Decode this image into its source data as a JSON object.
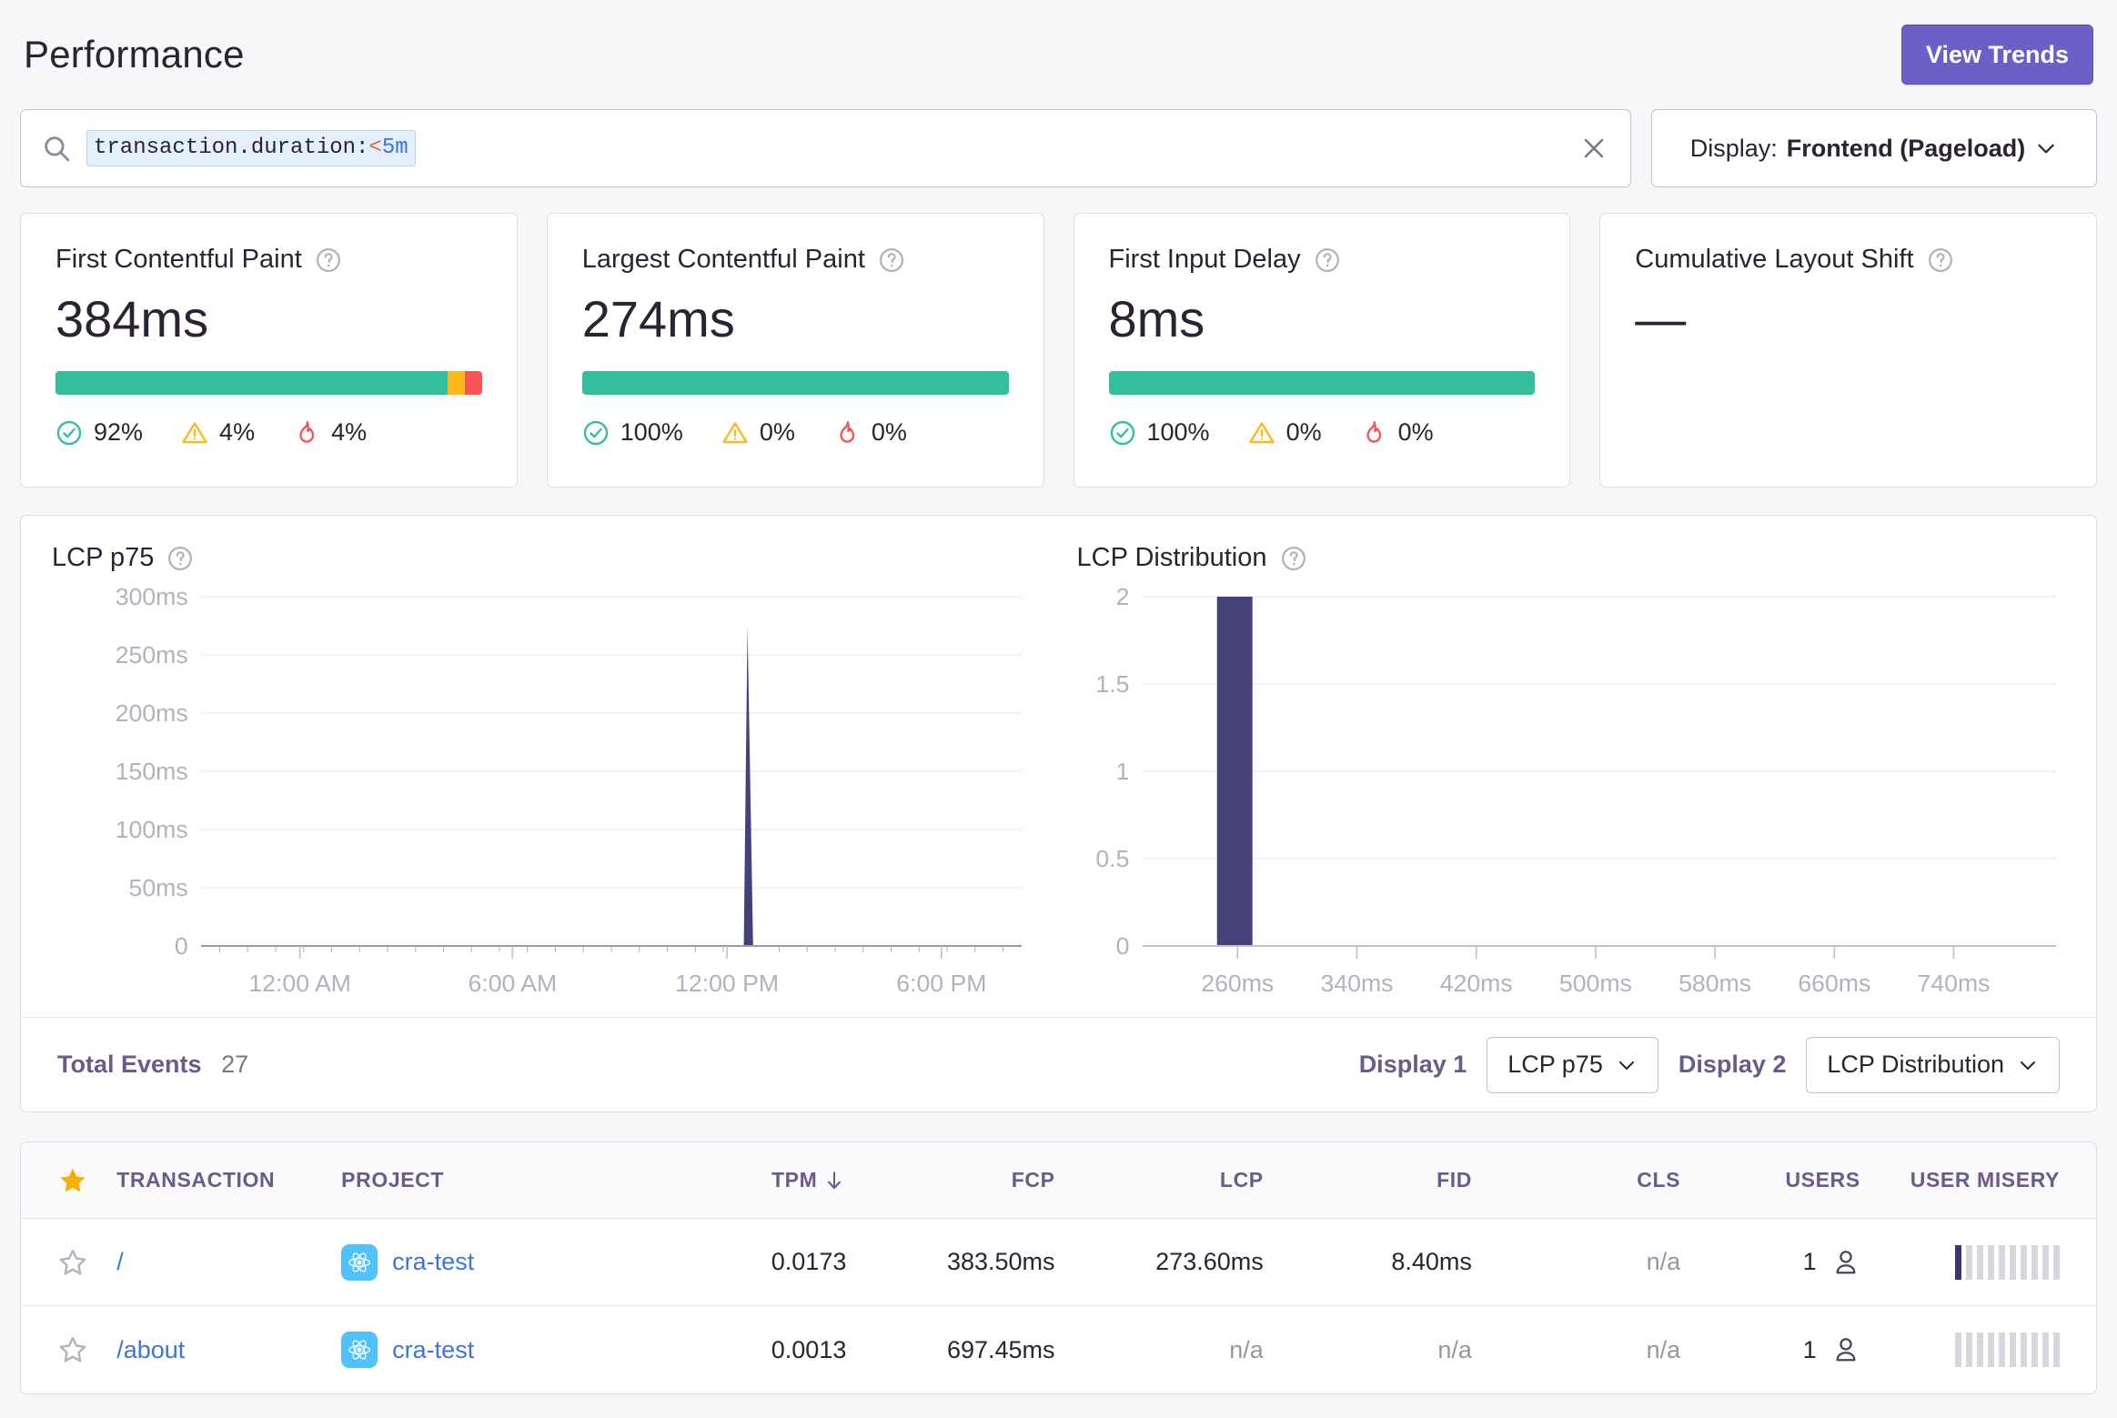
{
  "header": {
    "title": "Performance",
    "view_trends_label": "View Trends"
  },
  "search": {
    "icon": "search-icon",
    "token_field": "transaction.duration",
    "token_sep": ":",
    "token_op": "<",
    "token_value": "5m",
    "clear_icon": "close-icon"
  },
  "display_filter": {
    "label": "Display:",
    "value": "Frontend (Pageload)",
    "chevron": "chevron-down-icon"
  },
  "vitals": [
    {
      "title": "First Contentful Paint",
      "value": "384ms",
      "help_icon": "question-circle-icon",
      "has_bar": true,
      "segments": {
        "good": 92,
        "meh": 4,
        "poor": 4
      },
      "stats": [
        {
          "icon": "check-circle-icon",
          "value": "92%"
        },
        {
          "icon": "warning-triangle-icon",
          "value": "4%"
        },
        {
          "icon": "fire-icon",
          "value": "4%"
        }
      ]
    },
    {
      "title": "Largest Contentful Paint",
      "value": "274ms",
      "help_icon": "question-circle-icon",
      "has_bar": true,
      "segments": {
        "good": 100,
        "meh": 0,
        "poor": 0
      },
      "stats": [
        {
          "icon": "check-circle-icon",
          "value": "100%"
        },
        {
          "icon": "warning-triangle-icon",
          "value": "0%"
        },
        {
          "icon": "fire-icon",
          "value": "0%"
        }
      ]
    },
    {
      "title": "First Input Delay",
      "value": "8ms",
      "help_icon": "question-circle-icon",
      "has_bar": true,
      "segments": {
        "good": 100,
        "meh": 0,
        "poor": 0
      },
      "stats": [
        {
          "icon": "check-circle-icon",
          "value": "100%"
        },
        {
          "icon": "warning-triangle-icon",
          "value": "0%"
        },
        {
          "icon": "fire-icon",
          "value": "0%"
        }
      ]
    },
    {
      "title": "Cumulative Layout Shift",
      "value": "—",
      "help_icon": "question-circle-icon",
      "has_bar": false,
      "segments": null,
      "stats": []
    }
  ],
  "charts_footer": {
    "total_events_label": "Total Events",
    "total_events_count": "27",
    "display1_label": "Display 1",
    "display1_value": "LCP p75",
    "display2_label": "Display 2",
    "display2_value": "LCP Distribution",
    "chevron": "chevron-down-icon"
  },
  "table": {
    "star_header_icon": "star-filled-icon",
    "columns": [
      "TRANSACTION",
      "PROJECT",
      "TPM",
      "FCP",
      "LCP",
      "FID",
      "CLS",
      "USERS",
      "USER MISERY"
    ],
    "sort_column": "TPM",
    "sort_icon": "arrow-down-icon",
    "rows": [
      {
        "star_icon": "star-outline-icon",
        "transaction": "/",
        "project": "cra-test",
        "project_icon": "react-logo-icon",
        "tpm": "0.0173",
        "fcp": "383.50ms",
        "lcp": "273.60ms",
        "fid": "8.40ms",
        "cls": "n/a",
        "users": "1",
        "users_icon": "user-icon",
        "misery_filled": 1,
        "misery_total": 10
      },
      {
        "star_icon": "star-outline-icon",
        "transaction": "/about",
        "project": "cra-test",
        "project_icon": "react-logo-icon",
        "tpm": "0.0013",
        "fcp": "697.45ms",
        "lcp": "n/a",
        "fid": "n/a",
        "cls": "n/a",
        "users": "1",
        "users_icon": "user-icon",
        "misery_filled": 0,
        "misery_total": 10
      }
    ]
  },
  "colors": {
    "accent": "#6c5fc7",
    "good": "#33bf9e",
    "meh": "#fdb81b",
    "poor": "#f55459",
    "chart_bar": "#444279",
    "link": "#3d74db"
  },
  "chart_data": [
    {
      "type": "line",
      "title": "LCP p75",
      "xlabel": "",
      "ylabel": "",
      "x": [
        "12:00 AM",
        "6:00 AM",
        "12:00 PM",
        "6:00 PM"
      ],
      "ytick_labels": [
        "0",
        "50ms",
        "100ms",
        "150ms",
        "200ms",
        "250ms",
        "300ms"
      ],
      "ytick_values": [
        0,
        50,
        100,
        150,
        200,
        250,
        300
      ],
      "ylim": [
        0,
        310
      ],
      "grid": true,
      "legend": "none",
      "spike_time": "2:10 PM",
      "spike_value": 274,
      "values": [
        0,
        0,
        0,
        274,
        0,
        0
      ]
    },
    {
      "type": "bar",
      "title": "LCP Distribution",
      "xlabel": "",
      "ylabel": "",
      "categories": [
        "260ms",
        "340ms",
        "420ms",
        "500ms",
        "580ms",
        "660ms",
        "740ms"
      ],
      "values": [
        2,
        0,
        0,
        0,
        0,
        0,
        0
      ],
      "ytick_labels": [
        "0",
        "0.5",
        "1",
        "1.5",
        "2"
      ],
      "ytick_values": [
        0,
        0.5,
        1,
        1.5,
        2
      ],
      "ylim": [
        0,
        2
      ],
      "grid": true,
      "legend": "none"
    }
  ]
}
